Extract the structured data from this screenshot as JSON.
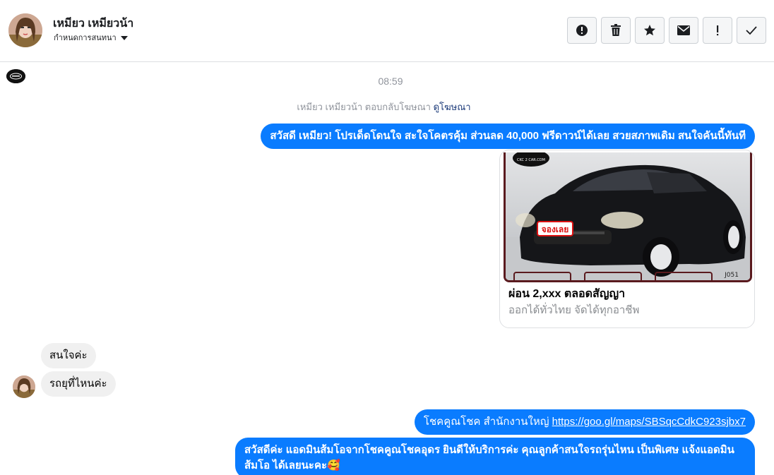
{
  "header": {
    "contact_name": "เหมียว เหมียวน้า",
    "subtitle": "กำหนดการสนทนา"
  },
  "toolbar": {
    "buttons": [
      {
        "icon": "alert-circle-icon"
      },
      {
        "icon": "trash-icon"
      },
      {
        "icon": "star-icon"
      },
      {
        "icon": "envelope-icon"
      },
      {
        "icon": "exclamation-icon"
      },
      {
        "icon": "check-icon"
      }
    ]
  },
  "chat": {
    "time": "08:59",
    "notice_text": "เหมียว เหมียวน้า ตอบกลับโฆษณา",
    "notice_link": "ดูโฆษณา",
    "messages": {
      "m1": "สวัสดี เหมียว! โปรเด็ดโดนใจ สะใจโคตรคุ้ม ส่วนลด 40,000 ฟรีดาวน์ได้เลย สวยสภาพเดิม สนใจคันนี้ทันที",
      "in1": "สนใจค่ะ",
      "in2": "รถยุที่ไหนค่ะ",
      "m2_text": "โชคคูณโชค สำนักงานใหญ่",
      "m2_link": "https://goo.gl/maps/SBSqcCdkC923sjbx7",
      "m3": "สวัสดีค่ะ แอดมินส้มโอจากโชคคูณโชคอุดร ยินดีให้บริการค่ะ   คุณลูกค้าสนใจรถรุ่นไหน เป็นพิเศษ แจ้งแอดมินส้มโอ ได้เลยนะคะ🥰"
    },
    "ad": {
      "title": "ผ่อน 2,xxx ตลอดสัญญา",
      "subtitle": "ออกได้ทั่วไทย จัดได้ทุกอาชีพ",
      "badge": "จองเลย",
      "brand": "CKC 2 CAR.COM",
      "code": "J051"
    }
  },
  "colors": {
    "outgoing": "#0a7cff",
    "incoming": "#f0f0f0",
    "muted": "#90949c",
    "link": "#1d3b7a"
  }
}
